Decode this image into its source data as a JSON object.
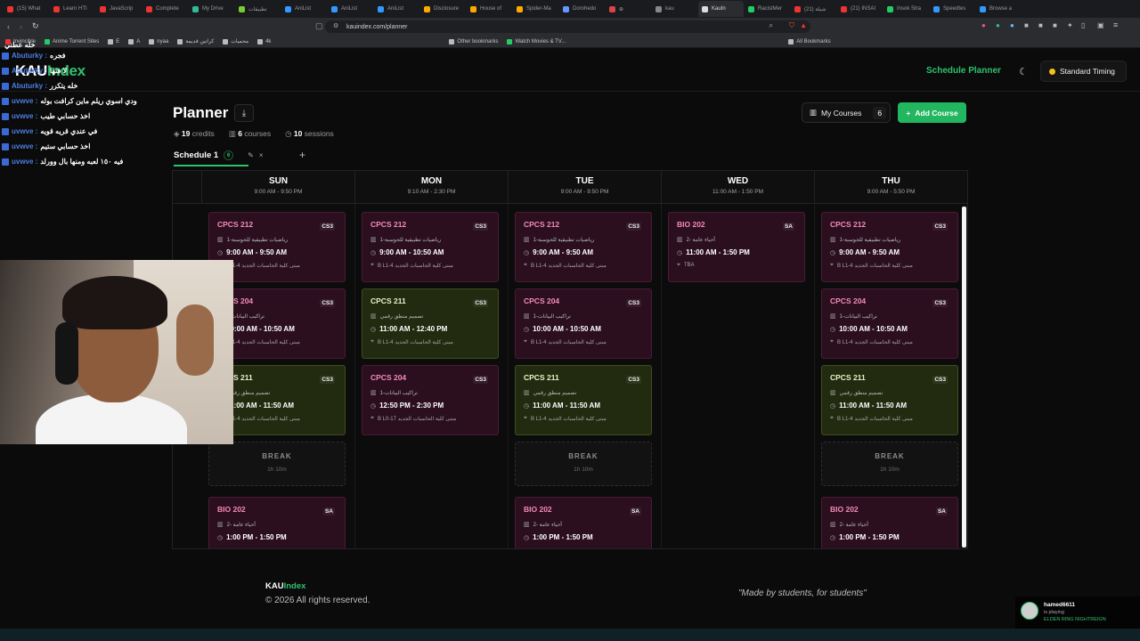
{
  "browser": {
    "tabs": [
      {
        "label": "(15) What",
        "color": "#e33"
      },
      {
        "label": "Learn HTI",
        "color": "#e33"
      },
      {
        "label": "JavaScrip",
        "color": "#e33"
      },
      {
        "label": "Complete",
        "color": "#e33"
      },
      {
        "label": "My Drive",
        "color": "#3b9"
      },
      {
        "label": "تطبيقات",
        "color": "#7c3"
      },
      {
        "label": "AniList",
        "color": "#39f"
      },
      {
        "label": "AniList",
        "color": "#39f"
      },
      {
        "label": "AniList",
        "color": "#39f"
      },
      {
        "label": "Disclosure",
        "color": "#fa0"
      },
      {
        "label": "House of",
        "color": "#fa0"
      },
      {
        "label": "Spider-Ma",
        "color": "#fa0"
      },
      {
        "label": "Dorohedo",
        "color": "#69f"
      },
      {
        "label": "⊕",
        "color": "#d44"
      },
      {
        "label": "kau",
        "color": "#888"
      },
      {
        "label": "KauIn",
        "color": "#ddd",
        "active": true
      },
      {
        "label": "RacistMer",
        "color": "#2c6"
      },
      {
        "label": "(21) شيلة",
        "color": "#e33"
      },
      {
        "label": "(21) INSAI",
        "color": "#e33"
      },
      {
        "label": "Insok Stra",
        "color": "#2c6"
      },
      {
        "label": "Speedtes",
        "color": "#39f"
      },
      {
        "label": "Browse a",
        "color": "#39f"
      }
    ],
    "url": "kauindex.com/planner",
    "bookmarks": [
      "Invincible",
      "Anime Torrent Sites",
      "E",
      "A",
      "nyaa",
      "كراتين قديمة",
      "محميات",
      "4k",
      "Other bookmarks",
      "Watch Movies & TV...",
      "All Bookmarks"
    ]
  },
  "chat": [
    {
      "user": "",
      "msg": "خله عطني"
    },
    {
      "user": "Abuturky :",
      "msg": "فجره"
    },
    {
      "user": "Abuturky :",
      "msg": "لا فتها"
    },
    {
      "user": "Abuturky :",
      "msg": "خله يتكرر"
    },
    {
      "user": "uvwve :",
      "msg": "ودي اسوي ريلم ماين كرافت بوله"
    },
    {
      "user": "uvwve :",
      "msg": "اخذ حسابي طيب"
    },
    {
      "user": "uvwve :",
      "msg": "في عندي قريه قويه"
    },
    {
      "user": "uvwve :",
      "msg": "اخذ حسابي ستيم"
    },
    {
      "user": "uvwve :",
      "msg": "فيه ١٥٠ لعبه ومنها بال وورلد"
    }
  ],
  "header": {
    "brand_a": "KAU",
    "brand_b": "Index",
    "nav_link": "Schedule Planner",
    "timing": "Standard Timing"
  },
  "page": {
    "title": "Planner",
    "credits": "19",
    "credits_label": "credits",
    "courses": "6",
    "courses_label": "courses",
    "sessions": "10",
    "sessions_label": "sessions",
    "my_courses": "My Courses",
    "my_courses_count": "6",
    "add_course": "Add Course",
    "schedule_tab": "Schedule 1",
    "schedule_tab_count": "6"
  },
  "days": [
    {
      "name": "SUN",
      "time": "9:00 AM - 9:50 PM"
    },
    {
      "name": "MON",
      "time": "9:10 AM - 2:30 PM"
    },
    {
      "name": "TUE",
      "time": "9:00 AM - 9:50 PM"
    },
    {
      "name": "WED",
      "time": "11:00 AM - 1:50 PM"
    },
    {
      "name": "THU",
      "time": "9:00 AM - 5:50 PM"
    }
  ],
  "sessions": [
    [
      {
        "type": "course",
        "code": "CPCS 212",
        "tag": "CS3",
        "name": "رياضيات تطبيقية للحوسبة-1",
        "time": "9:00 AM - 9:50 AM",
        "room": "B L1-4 مبنى كلية الحاسبات الجديد",
        "color": "pink"
      },
      {
        "type": "course",
        "code": "CPCS 204",
        "tag": "CS3",
        "name": "تراكيب البيانات-1",
        "time": "10:00 AM - 10:50 AM",
        "room": "B L1-4 مبنى كلية الحاسبات الجديد",
        "color": "pink"
      },
      {
        "type": "course",
        "code": "CPCS 211",
        "tag": "CS3",
        "name": "تصميم منطق رقمي",
        "time": "11:00 AM - 11:50 AM",
        "room": "B L1-4 مبنى كلية الحاسبات الجديد",
        "color": "green"
      },
      {
        "type": "break",
        "label": "BREAK",
        "dur": "1h 10m"
      },
      {
        "type": "course",
        "code": "BIO 202",
        "tag": "SA",
        "name": "أحياء عامة -2",
        "time": "1:00 PM - 1:50 PM",
        "room": "",
        "color": "pink"
      }
    ],
    [
      {
        "type": "course",
        "code": "CPCS 212",
        "tag": "CS3",
        "name": "رياضيات تطبيقية للحوسبة-1",
        "time": "9:00 AM - 10:50 AM",
        "room": "B L1-4 مبنى كلية الحاسبات الجديد",
        "color": "pink"
      },
      {
        "type": "course",
        "code": "CPCS 211",
        "tag": "CS3",
        "name": "تصميم منطق رقمي",
        "time": "11:00 AM - 12:40 PM",
        "room": "B L1-4 مبنى كلية الحاسبات الجديد",
        "color": "green"
      },
      {
        "type": "course",
        "code": "CPCS 204",
        "tag": "CS3",
        "name": "تراكيب البيانات-1",
        "time": "12:50 PM - 2:30 PM",
        "room": "B L0-17 مبنى كلية الحاسبات الجديد",
        "color": "pink"
      }
    ],
    [
      {
        "type": "course",
        "code": "CPCS 212",
        "tag": "CS3",
        "name": "رياضيات تطبيقية للحوسبة-1",
        "time": "9:00 AM - 9:50 AM",
        "room": "B L1-4 مبنى كلية الحاسبات الجديد",
        "color": "pink"
      },
      {
        "type": "course",
        "code": "CPCS 204",
        "tag": "CS3",
        "name": "تراكيب البيانات-1",
        "time": "10:00 AM - 10:50 AM",
        "room": "B L1-4 مبنى كلية الحاسبات الجديد",
        "color": "pink"
      },
      {
        "type": "course",
        "code": "CPCS 211",
        "tag": "CS3",
        "name": "تصميم منطق رقمي",
        "time": "11:00 AM - 11:50 AM",
        "room": "B L1-4 مبنى كلية الحاسبات الجديد",
        "color": "green"
      },
      {
        "type": "break",
        "label": "BREAK",
        "dur": "1h 10m"
      },
      {
        "type": "course",
        "code": "BIO 202",
        "tag": "SA",
        "name": "أحياء عامة -2",
        "time": "1:00 PM - 1:50 PM",
        "room": "",
        "color": "pink"
      }
    ],
    [
      {
        "type": "course",
        "code": "BIO 202",
        "tag": "SA",
        "name": "أحياء عامة -2",
        "time": "11:00 AM - 1:50 PM",
        "room": "TBA",
        "color": "pink"
      }
    ],
    [
      {
        "type": "course",
        "code": "CPCS 212",
        "tag": "CS3",
        "name": "رياضيات تطبيقية للحوسبة-1",
        "time": "9:00 AM - 9:50 AM",
        "room": "B L1-4 مبنى كلية الحاسبات الجديد",
        "color": "pink"
      },
      {
        "type": "course",
        "code": "CPCS 204",
        "tag": "CS3",
        "name": "تراكيب البيانات-1",
        "time": "10:00 AM - 10:50 AM",
        "room": "B L1-4 مبنى كلية الحاسبات الجديد",
        "color": "pink"
      },
      {
        "type": "course",
        "code": "CPCS 211",
        "tag": "CS3",
        "name": "تصميم منطق رقمي",
        "time": "11:00 AM - 11:50 AM",
        "room": "B L1-4 مبنى كلية الحاسبات الجديد",
        "color": "green"
      },
      {
        "type": "break",
        "label": "BREAK",
        "dur": "1h 10m"
      },
      {
        "type": "course",
        "code": "BIO 202",
        "tag": "SA",
        "name": "أحياء عامة -2",
        "time": "1:00 PM - 1:50 PM",
        "room": "",
        "color": "pink"
      }
    ]
  ],
  "footer": {
    "brand_a": "KAU",
    "brand_b": "Index",
    "copyright": "© 2026 All rights reserved.",
    "motto": "\"Made by students, for students\""
  },
  "notification": {
    "user": "hamed6611",
    "status": "is playing",
    "game": "ELDEN RING NIGHTREIGN"
  }
}
